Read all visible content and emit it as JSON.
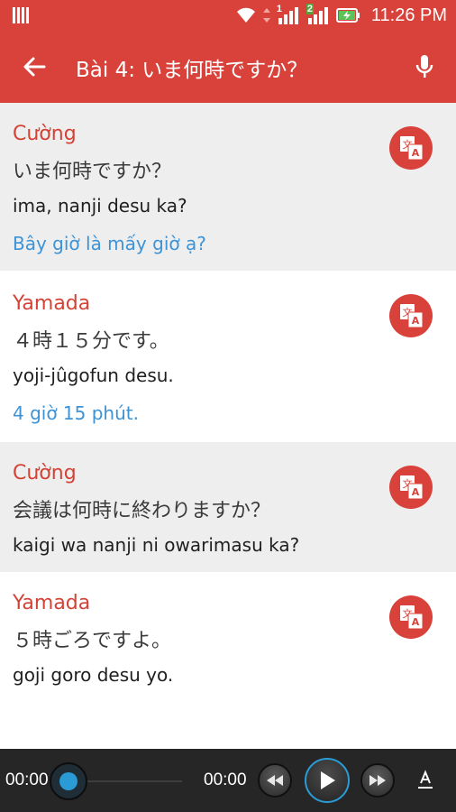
{
  "status_bar": {
    "time": "11:26 PM",
    "sim1_label": "1",
    "sim2_label": "2"
  },
  "app_bar": {
    "title": "Bài 4: いま何時ですか？"
  },
  "dialog": [
    {
      "speaker": "Cường",
      "japanese": "いま何時ですか？",
      "romaji": "ima, nanji desu ka?",
      "vietnamese": "Bây giờ là mấy giờ ạ?"
    },
    {
      "speaker": "Yamada",
      "japanese": "４時１５分です。",
      "romaji": "yoji-jûgofun desu.",
      "vietnamese": "4 giờ 15 phút."
    },
    {
      "speaker": "Cường",
      "japanese": "会議は何時に終わりますか？",
      "romaji": "kaigi wa nanji ni owarimasu ka?",
      "vietnamese": ""
    },
    {
      "speaker": "Yamada",
      "japanese": "５時ごろですよ。",
      "romaji": "goji goro desu yo.",
      "vietnamese": ""
    }
  ],
  "player": {
    "current_time": "00:00",
    "total_time": "00:00",
    "progress": 0
  },
  "colors": {
    "accent": "#d8423a",
    "speaker": "#d44236",
    "translation": "#3d93d6",
    "player_bg": "#262626"
  }
}
